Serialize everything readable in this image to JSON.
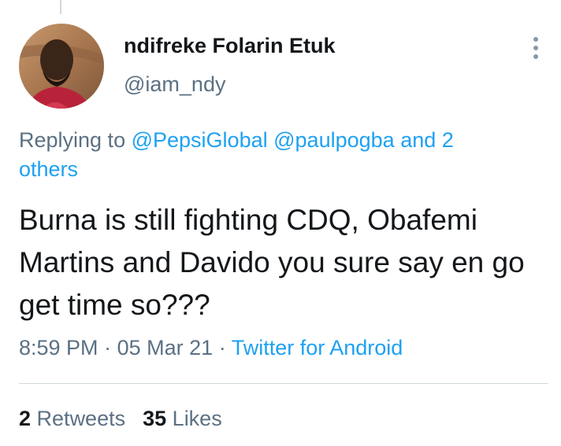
{
  "tweet": {
    "author": {
      "display_name": "ndifreke Folarin Etuk",
      "handle": "@iam_ndy"
    },
    "replying": {
      "prefix": "Replying to",
      "mentions": [
        "@PepsiGlobal",
        "@paulpogba"
      ],
      "others": "and 2 others"
    },
    "text": "Burna is still fighting CDQ, Obafemi Martins and Davido you sure say en go get time so???",
    "time": "8:59 PM",
    "date": "05 Mar 21",
    "separator": "·",
    "source": "Twitter for Android",
    "stats": {
      "retweets_count": "2",
      "retweets_label": "Retweets",
      "likes_count": "35",
      "likes_label": "Likes"
    }
  },
  "icons": {
    "more": "more-vertical-icon",
    "avatar": "user-avatar"
  },
  "colors": {
    "link": "#1da1f2",
    "secondary_text": "#5b7083",
    "primary_text": "#14171a",
    "divider": "#cfd9de"
  }
}
